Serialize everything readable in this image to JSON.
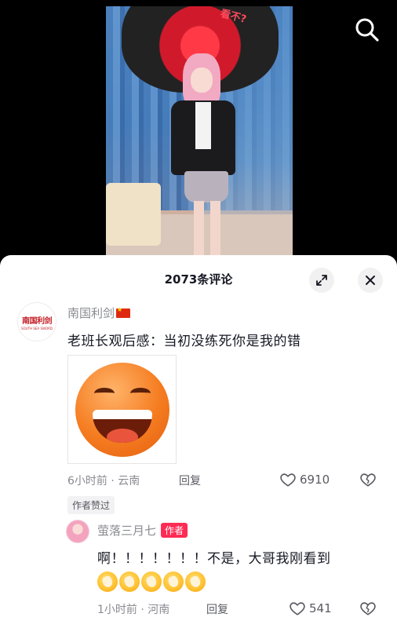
{
  "video": {
    "umbrella_text": "看不?"
  },
  "panel": {
    "title": "2073条评论"
  },
  "comments": [
    {
      "username": "南国利剑",
      "avatar_logo_cn": "南国利剑",
      "avatar_logo_en": "SOUTH SEA SWORD",
      "text": "老班长观后感：当初没练死你是我的错",
      "meta": "6小时前 · 云南",
      "reply_label": "回复",
      "likes": "6910",
      "author_liked": "作者赞过",
      "replies": [
        {
          "username": "萤落三月七",
          "badge": "作者",
          "text": "啊！！！！！！！不是，大哥我刚看到",
          "emoji_count": 5,
          "meta": "1小时前 · 河南",
          "reply_label": "回复",
          "likes": "541"
        }
      ]
    }
  ],
  "icons": {
    "search": "search-icon",
    "expand": "expand-icon",
    "close": "close-icon",
    "like": "heart-icon",
    "dislike": "broken-heart-icon"
  },
  "colors": {
    "accent": "#fe2c55",
    "text_primary": "#161823",
    "text_secondary": "#8a8b91"
  }
}
